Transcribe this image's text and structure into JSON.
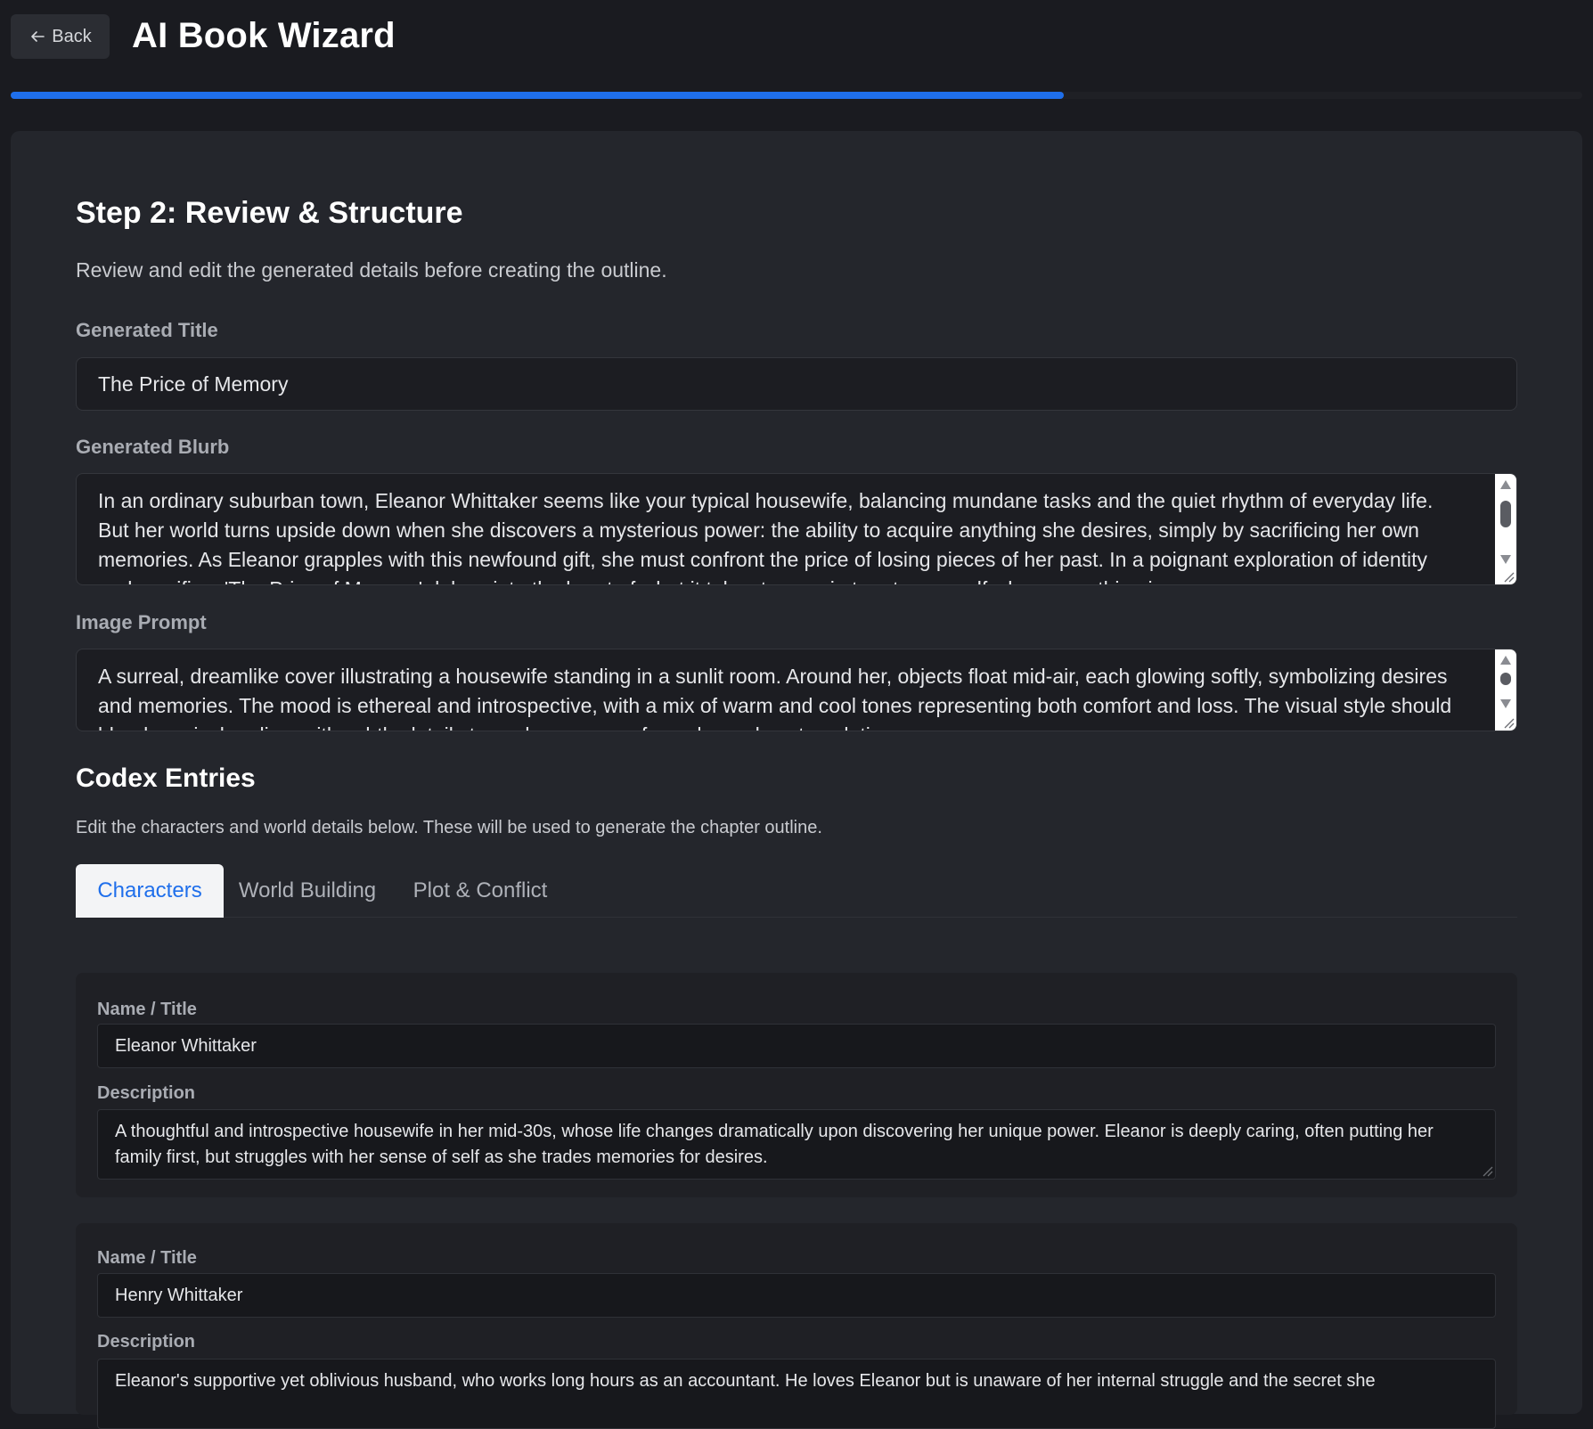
{
  "header": {
    "back_label": "Back",
    "title": "AI Book Wizard",
    "progress": 0.67
  },
  "step": {
    "title": "Step 2: Review & Structure",
    "subtitle": "Review and edit the generated details before creating the outline."
  },
  "fields": {
    "title_label": "Generated Title",
    "title_value": "The Price of Memory",
    "blurb_label": "Generated Blurb",
    "blurb_value": "In an ordinary suburban town, Eleanor Whittaker seems like your typical housewife, balancing mundane tasks and the quiet rhythm of everyday life. But her world turns upside down when she discovers a mysterious power: the ability to acquire anything she desires, simply by sacrificing her own memories. As Eleanor grapples with this newfound gift, she must confront the price of losing pieces of her past. In a poignant exploration of identity and sacrifice, 'The Price of Memory' delves into the heart of what it takes to remain true to yourself when everything is",
    "image_prompt_label": "Image Prompt",
    "image_prompt_value": "A surreal, dreamlike cover illustrating a housewife standing in a sunlit room. Around her, objects float mid-air, each glowing softly, symbolizing desires and memories. The mood is ethereal and introspective, with a mix of warm and cool tones representing both comfort and loss. The visual style should blend magical realism with subtle details to evoke a sense of wonder and contemplation."
  },
  "codex": {
    "title": "Codex Entries",
    "subtitle": "Edit the characters and world details below. These will be used to generate the chapter outline.",
    "tabs": [
      {
        "label": "Characters",
        "active": true
      },
      {
        "label": "World Building",
        "active": false
      },
      {
        "label": "Plot & Conflict",
        "active": false
      }
    ],
    "entries": [
      {
        "name_label": "Name / Title",
        "name": "Eleanor Whittaker",
        "desc_label": "Description",
        "description": "A thoughtful and introspective housewife in her mid-30s, whose life changes dramatically upon discovering her unique power. Eleanor is deeply caring, often putting her family first, but struggles with her sense of self as she trades memories for desires."
      },
      {
        "name_label": "Name / Title",
        "name": "Henry Whittaker",
        "desc_label": "Description",
        "description": "Eleanor's supportive yet oblivious husband, who works long hours as an accountant. He loves Eleanor but is unaware of her internal struggle and the secret she"
      }
    ]
  },
  "colors": {
    "accent": "#1f6feb",
    "background": "#1a1b20",
    "card": "#24262c"
  }
}
